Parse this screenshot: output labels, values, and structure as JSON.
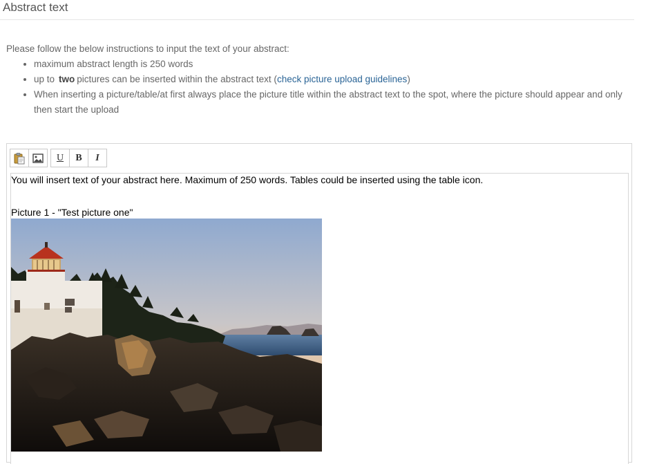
{
  "header": {
    "title": "Abstract text"
  },
  "instructions": {
    "intro": "Please follow the below instructions to input the text of your abstract:",
    "items": [
      {
        "text": "maximum abstract length is 250 words"
      },
      {
        "prefix": "up to",
        "strong": "two",
        "middle": "pictures can be inserted within the abstract text (",
        "link": "check picture upload guidelines",
        "suffix": ")"
      },
      {
        "text": "When inserting a picture/table/at first always place the picture title within the abstract text to the spot, where the picture should appear and only then start the upload"
      }
    ]
  },
  "toolbar": {
    "paste_icon": "paste-icon",
    "image_icon": "image-icon",
    "underline_label": "U",
    "bold_label": "B",
    "italic_label": "I"
  },
  "editor": {
    "content_text": "You will insert text of your abstract here. Maximum of 250 words. Tables could be inserted using the table icon.",
    "picture_caption": "Picture 1 - \"Test picture one\"",
    "picture": "lighthouse-photo"
  },
  "colors": {
    "link": "#2a6496",
    "instruction_text": "#666666",
    "border": "#d6d6d6"
  }
}
